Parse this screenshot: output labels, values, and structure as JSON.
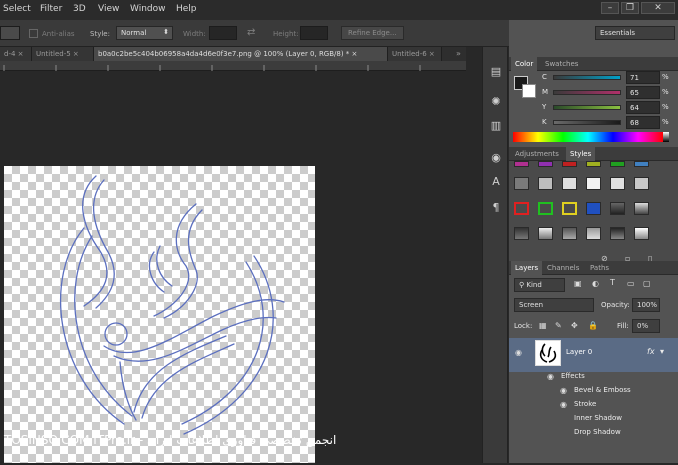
{
  "menu": {
    "items": [
      "Select",
      "Filter",
      "3D",
      "View",
      "Window",
      "Help"
    ]
  },
  "options": {
    "antialias": "Anti-alias",
    "style_label": "Style:",
    "style_value": "Normal",
    "width_label": "Width:",
    "height_label": "Height:",
    "refine_edge": "Refine Edge..."
  },
  "tabs": [
    {
      "label": "d-4"
    },
    {
      "label": "Untitled-5"
    },
    {
      "label": "b0a0c2be5c404b06958a4da4d6e0f3e7.png @ 100% (Layer 0, RGB/8) *"
    },
    {
      "label": "Untitled-6"
    }
  ],
  "workspace": "Essentials",
  "color_panel": {
    "tabs": [
      "Color",
      "Swatches"
    ],
    "channels": [
      {
        "label": "C",
        "value": "71",
        "unit": "%"
      },
      {
        "label": "M",
        "value": "65",
        "unit": "%"
      },
      {
        "label": "Y",
        "value": "64",
        "unit": "%"
      },
      {
        "label": "K",
        "value": "68",
        "unit": "%"
      }
    ]
  },
  "styles_panel": {
    "tabs": [
      "Adjustments",
      "Styles"
    ]
  },
  "layers_panel": {
    "tabs": [
      "Layers",
      "Channels",
      "Paths"
    ],
    "filter": "Kind",
    "blend_mode": "Screen",
    "opacity_label": "Opacity:",
    "opacity_value": "100%",
    "lock_label": "Lock:",
    "fill_label": "Fill:",
    "fill_value": "0%",
    "layer_name": "Layer 0",
    "fx_badge": "fx",
    "effects_label": "Effects",
    "effects": [
      "Bevel & Emboss",
      "Stroke",
      "Inner Shadow",
      "Drop Shadow"
    ]
  },
  "watermark": "TOSINSO.COM           ITPro.ir - انجمن تخصصی فناوری اطلاعات ایران"
}
